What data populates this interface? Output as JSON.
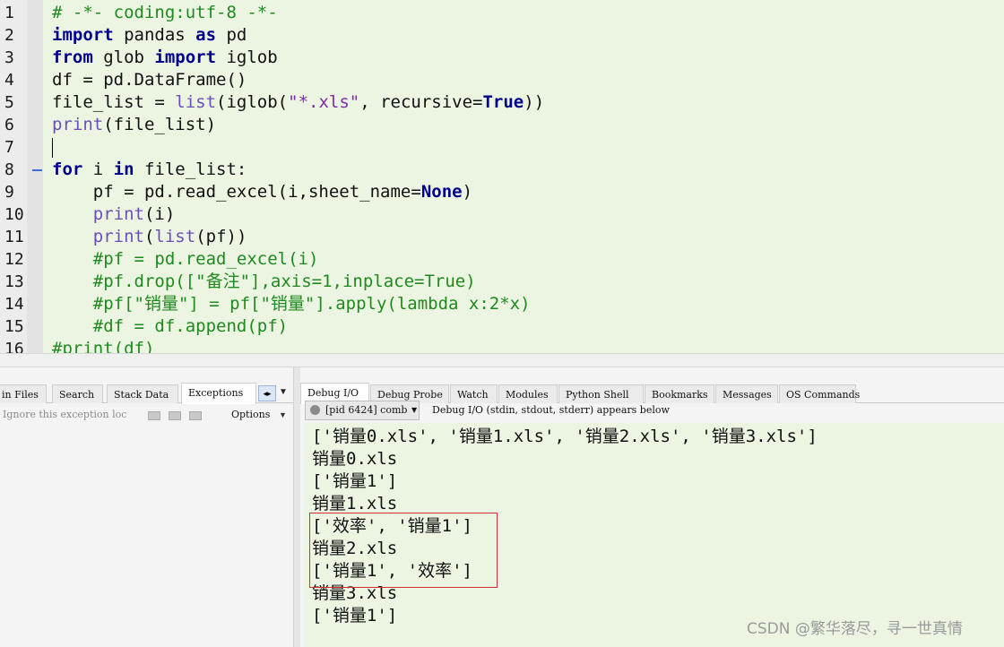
{
  "editor": {
    "lines": [
      {
        "n": "1",
        "tokens": [
          {
            "t": "# -*- coding:utf-8 -*-",
            "c": "cm"
          }
        ]
      },
      {
        "n": "2",
        "tokens": [
          {
            "t": "import",
            "c": "kw"
          },
          {
            "t": " pandas "
          },
          {
            "t": "as",
            "c": "kw"
          },
          {
            "t": " pd"
          }
        ]
      },
      {
        "n": "3",
        "tokens": [
          {
            "t": "from",
            "c": "kw"
          },
          {
            "t": " glob "
          },
          {
            "t": "import",
            "c": "kw"
          },
          {
            "t": " iglob"
          }
        ]
      },
      {
        "n": "4",
        "tokens": [
          {
            "t": "df = pd.DataFrame()"
          }
        ]
      },
      {
        "n": "5",
        "tokens": [
          {
            "t": "file_list = "
          },
          {
            "t": "list",
            "c": "bi"
          },
          {
            "t": "(iglob("
          },
          {
            "t": "\"*.xls\"",
            "c": "st"
          },
          {
            "t": ", recursive="
          },
          {
            "t": "True",
            "c": "kw"
          },
          {
            "t": "))"
          }
        ]
      },
      {
        "n": "6",
        "tokens": [
          {
            "t": "print",
            "c": "bi"
          },
          {
            "t": "(file_list)"
          }
        ]
      },
      {
        "n": "7",
        "tokens": []
      },
      {
        "n": "8",
        "tokens": [
          {
            "t": "for",
            "c": "kw"
          },
          {
            "t": " i "
          },
          {
            "t": "in",
            "c": "kw"
          },
          {
            "t": " file_list:"
          }
        ]
      },
      {
        "n": "9",
        "tokens": [
          {
            "t": "    pf = pd.read_excel(i,sheet_name="
          },
          {
            "t": "None",
            "c": "kw"
          },
          {
            "t": ")"
          }
        ]
      },
      {
        "n": "10",
        "tokens": [
          {
            "t": "    "
          },
          {
            "t": "print",
            "c": "bi"
          },
          {
            "t": "(i)"
          }
        ]
      },
      {
        "n": "11",
        "tokens": [
          {
            "t": "    "
          },
          {
            "t": "print",
            "c": "bi"
          },
          {
            "t": "("
          },
          {
            "t": "list",
            "c": "bi"
          },
          {
            "t": "(pf))"
          }
        ]
      },
      {
        "n": "12",
        "tokens": [
          {
            "t": "    #pf = pd.read_excel(i)",
            "c": "cm"
          }
        ]
      },
      {
        "n": "13",
        "tokens": [
          {
            "t": "    #pf.drop([\"备注\"],axis=1,inplace=True)",
            "c": "cm"
          }
        ]
      },
      {
        "n": "14",
        "tokens": [
          {
            "t": "    #pf[\"销量\"] = pf[\"销量\"].apply(lambda x:2*x)",
            "c": "cm"
          }
        ]
      },
      {
        "n": "15",
        "tokens": [
          {
            "t": "    #df = df.append(pf)",
            "c": "cm"
          }
        ]
      },
      {
        "n": "16",
        "tokens": [
          {
            "t": "#print(df)",
            "c": "cm"
          }
        ]
      }
    ]
  },
  "left_panel": {
    "tabs": [
      {
        "label": "in Files",
        "active": false
      },
      {
        "label": "Search",
        "active": false
      },
      {
        "label": "Stack Data",
        "active": false
      },
      {
        "label": "Exceptions",
        "active": true
      }
    ],
    "tab_scroll_icon": "◂▸",
    "tab_menu_icon": "▼",
    "toolbar": {
      "hint": "Ignore this exception loc",
      "options_label": "Options",
      "options_arrow": "▼"
    }
  },
  "right_panel": {
    "tabs": [
      {
        "label": "Debug I/O",
        "active": true
      },
      {
        "label": "Debug Probe",
        "active": false
      },
      {
        "label": "Watch",
        "active": false
      },
      {
        "label": "Modules",
        "active": false
      },
      {
        "label": "Python Shell",
        "active": false
      },
      {
        "label": "Bookmarks",
        "active": false
      },
      {
        "label": "Messages",
        "active": false
      },
      {
        "label": "OS Commands",
        "active": false
      }
    ],
    "process_selector": "[pid 6424] comb",
    "process_dropdown": "▼",
    "io_description": "Debug I/O (stdin, stdout, stderr) appears below",
    "output_lines": [
      "['销量0.xls', '销量1.xls', '销量2.xls', '销量3.xls']",
      "销量0.xls",
      "['销量1']",
      "销量1.xls",
      "['效率', '销量1']",
      "销量2.xls",
      "['销量1', '效率']",
      "销量3.xls",
      "['销量1']"
    ]
  },
  "watermark": "CSDN @繁华落尽，寻一世真情"
}
